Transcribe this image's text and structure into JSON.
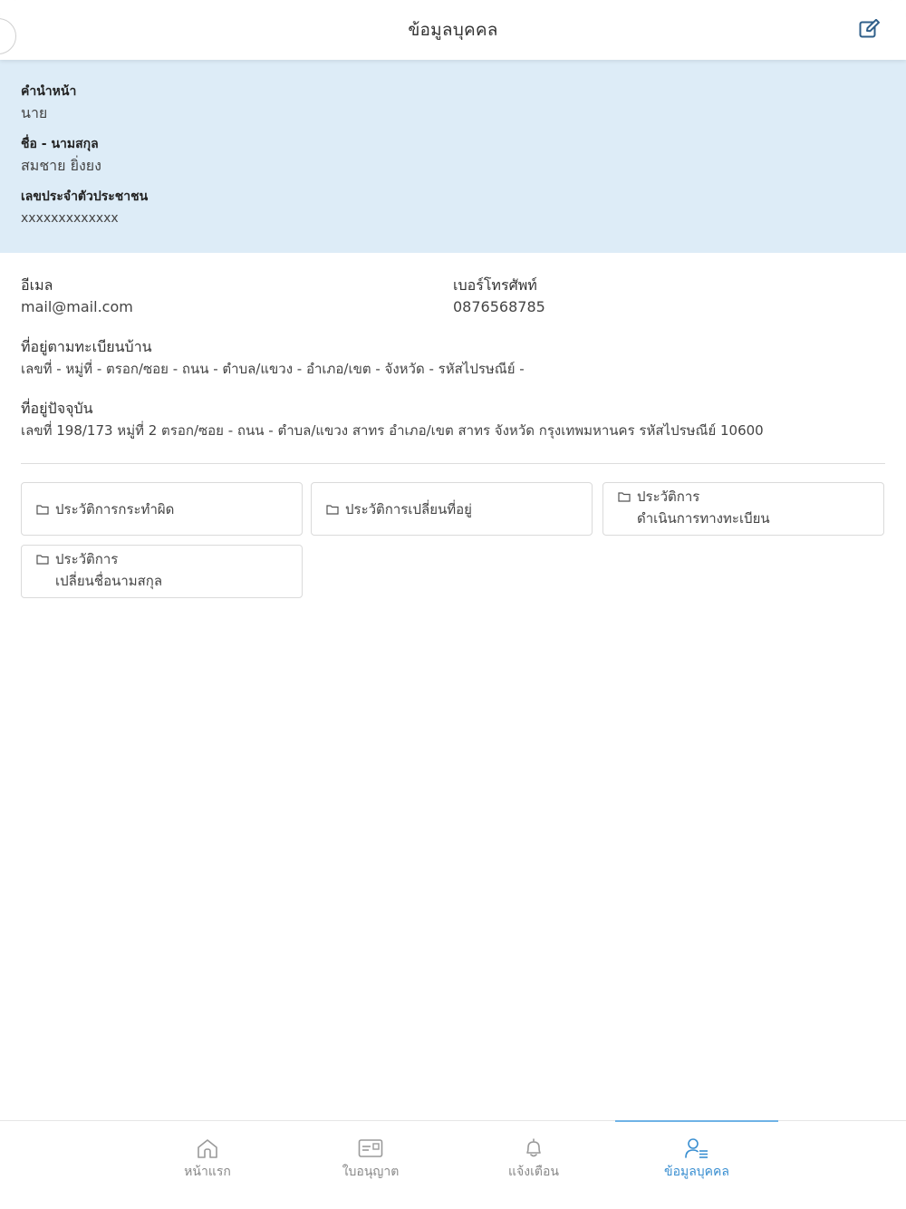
{
  "header": {
    "title": "ข้อมูลบุคคล"
  },
  "profile": {
    "prefix_label": "คำนำหน้า",
    "prefix_value": "นาย",
    "name_label": "ชื่อ - นามสกุล",
    "name_value": "สมชาย ยิ่งยง",
    "id_label": "เลขประจำตัวประชาชน",
    "id_value": "xxxxxxxxxxxxx"
  },
  "contact": {
    "email_label": "อีเมล",
    "email_value": "mail@mail.com",
    "phone_label": "เบอร์โทรศัพท์",
    "phone_value": "0876568785",
    "registered_address_label": "ที่อยู่ตามทะเบียนบ้าน",
    "registered_address_value": "เลขที่ - หมู่ที่ - ตรอก/ซอย - ถนน - ตำบล/แขวง - อำเภอ/เขต - จังหวัด - รหัสไปรษณีย์ -",
    "current_address_label": "ที่อยู่ปัจจุบัน",
    "current_address_value": "เลขที่ 198/173 หมู่ที่ 2 ตรอก/ซอย - ถนน - ตำบล/แขวง สาทร อำเภอ/เขต สาทร จังหวัด กรุงเทพมหานคร รหัสไปรษณีย์ 10600"
  },
  "history_buttons": [
    {
      "line1": "ประวัติการกระทำผิด",
      "line2": ""
    },
    {
      "line1": "ประวัติการเปลี่ยนที่อยู่",
      "line2": ""
    },
    {
      "line1": "ประวัติการ",
      "line2": "ดำเนินการทางทะเบียน"
    },
    {
      "line1": "ประวัติการ",
      "line2": "เปลี่ยนชื่อนามสกุล"
    }
  ],
  "bottom_nav": {
    "items": [
      {
        "label": "หน้าแรก",
        "icon": "home-icon"
      },
      {
        "label": "ใบอนุญาต",
        "icon": "license-card-icon"
      },
      {
        "label": "แจ้งเตือน",
        "icon": "bell-icon"
      },
      {
        "label": "ข้อมูลบุคคล",
        "icon": "user-profile-icon"
      }
    ],
    "active_index": 3
  },
  "colors": {
    "profile_background": "#ddecf7",
    "accent": "#3a8fd1",
    "header_icon": "#2f5f8a"
  }
}
